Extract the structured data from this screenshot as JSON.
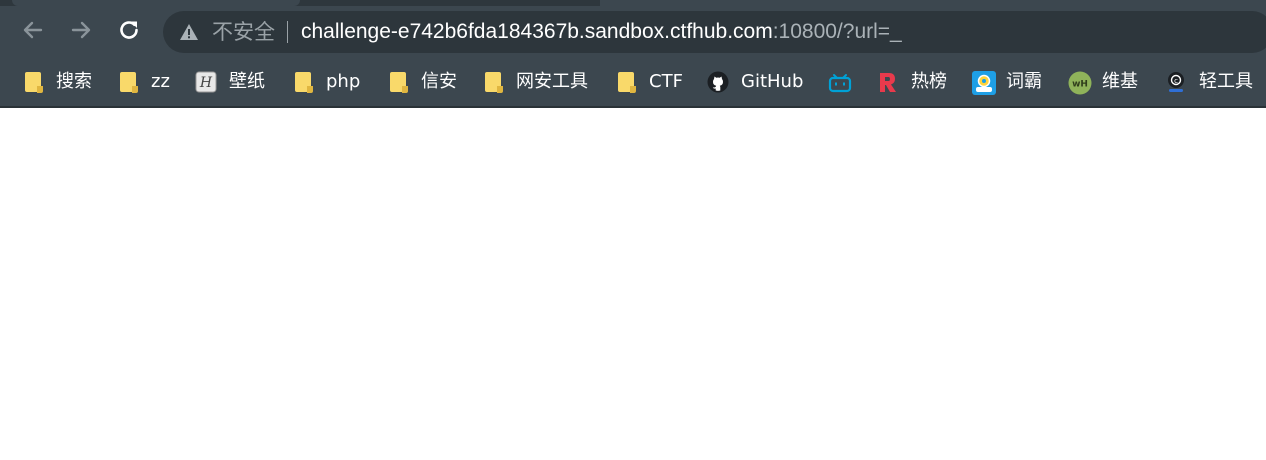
{
  "browser": {
    "toolbar": {
      "back_label": "←",
      "forward_label": "→",
      "reload_label": "⟳"
    },
    "omnibox": {
      "security_text": "不安全",
      "url_host": "challenge-e742b6fda184367b.sandbox.ctfhub.com",
      "url_rest": ":10800/?url=_"
    },
    "bookmarks": [
      {
        "label": "搜索",
        "icon": "folder-icon"
      },
      {
        "label": "zz",
        "icon": "folder-icon"
      },
      {
        "label": "壁纸",
        "icon": "h-logo-icon"
      },
      {
        "label": "php",
        "icon": "folder-icon"
      },
      {
        "label": "信安",
        "icon": "folder-icon"
      },
      {
        "label": "网安工具",
        "icon": "folder-icon"
      },
      {
        "label": "CTF",
        "icon": "folder-icon"
      },
      {
        "label": "GitHub",
        "icon": "github-icon"
      },
      {
        "label": "",
        "icon": "bilibili-icon"
      },
      {
        "label": "热榜",
        "icon": "r-logo-icon"
      },
      {
        "label": "词霸",
        "icon": "dictionary-icon"
      },
      {
        "label": "维基",
        "icon": "wiki-icon"
      },
      {
        "label": "轻工具",
        "icon": "tool-icon"
      }
    ],
    "colors": {
      "chrome_bg": "#3c474f",
      "omnibox_bg": "#2d363c",
      "folder": "#f9d96a",
      "bilibili": "#00a1d6",
      "r_logo": "#e83a4c"
    }
  }
}
